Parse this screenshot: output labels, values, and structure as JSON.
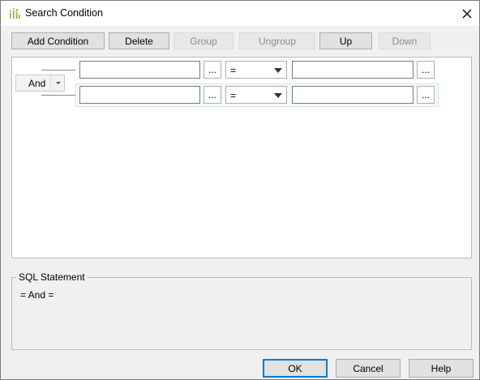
{
  "window": {
    "title": "Search Condition",
    "icon": "app-icon",
    "close_icon": "close-icon"
  },
  "toolbar": {
    "add_condition": "Add Condition",
    "delete": "Delete",
    "group": "Group",
    "ungroup": "Ungroup",
    "up": "Up",
    "down": "Down"
  },
  "conditions": {
    "logic_operator": "And",
    "rows": [
      {
        "left_value": "",
        "browse_left": "...",
        "operator": "=",
        "right_value": "",
        "browse_right": "..."
      },
      {
        "left_value": "",
        "browse_left": "...",
        "operator": "=",
        "right_value": "",
        "browse_right": "..."
      }
    ]
  },
  "sql": {
    "label": "SQL Statement",
    "statement": "= And ="
  },
  "footer": {
    "ok": "OK",
    "cancel": "Cancel",
    "help": "Help"
  }
}
